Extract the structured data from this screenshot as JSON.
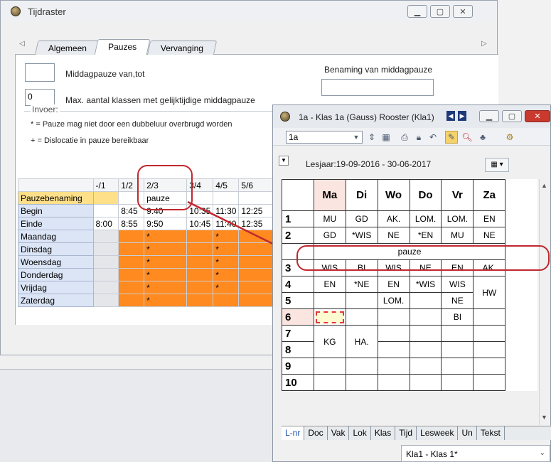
{
  "main_window": {
    "title": "Tijdraster",
    "tabs": [
      "Algemeen",
      "Pauzes",
      "Vervanging"
    ],
    "middagpauze_label": "Middagpauze van,tot",
    "middagpauze_value": "",
    "max_label": "Max. aantal klassen met gelijktijdige middagpauze",
    "max_value": "0",
    "benaming_label": "Benaming van middagpauze",
    "benaming_value": "",
    "invoer_label": "Invoer:",
    "invoer_line1": "* = Pauze mag niet door een dubbeluur overbrugd worden",
    "invoer_line2": "+ = Dislocatie in pauze bereikbaar"
  },
  "grid": {
    "columns": [
      "-/1",
      "1/2",
      "2/3",
      "3/4",
      "4/5",
      "5/6"
    ],
    "rows": [
      {
        "label": "Pauzebenaming",
        "cells": [
          "",
          "",
          "pauze",
          "",
          "",
          ""
        ]
      },
      {
        "label": "Begin",
        "cells": [
          "",
          "8:45",
          "9:40",
          "10:35",
          "11:30",
          "12:25"
        ]
      },
      {
        "label": "Einde",
        "cells": [
          "8:00",
          "8:55",
          "9:50",
          "10:45",
          "11:40",
          "12:35"
        ]
      },
      {
        "label": "Maandag",
        "cells": [
          "",
          "",
          "*",
          "",
          "*",
          ""
        ]
      },
      {
        "label": "Dinsdag",
        "cells": [
          "",
          "",
          "*",
          "",
          "*",
          ""
        ]
      },
      {
        "label": "Woensdag",
        "cells": [
          "",
          "",
          "*",
          "",
          "*",
          ""
        ]
      },
      {
        "label": "Donderdag",
        "cells": [
          "",
          "",
          "*",
          "",
          "*",
          ""
        ]
      },
      {
        "label": "Vrijdag",
        "cells": [
          "",
          "",
          "*",
          "",
          "*",
          ""
        ]
      },
      {
        "label": "Zaterdag",
        "cells": [
          "",
          "",
          "*",
          "",
          "",
          ""
        ]
      }
    ]
  },
  "schedule_window": {
    "title": "1a - Klas 1a (Gauss)  Rooster  (Kla1)",
    "class_value": "1a",
    "lesjaar": "Lesjaar:19-09-2016 - 30-06-2017",
    "days": [
      "Ma",
      "Di",
      "Wo",
      "Do",
      "Vr",
      "Za"
    ],
    "periods": [
      "1",
      "2",
      "3",
      "4",
      "5",
      "6",
      "7",
      "8",
      "9",
      "10"
    ],
    "pause_label": "pauze",
    "row1": [
      "MU",
      "GD",
      "AK.",
      "LOM.",
      "LOM.",
      "EN"
    ],
    "row2": [
      "GD",
      "*WIS",
      "NE",
      "*EN",
      "MU",
      "NE"
    ],
    "row3": [
      "WIS",
      "BI",
      "WIS",
      "NE",
      "EN",
      "AK."
    ],
    "row4": [
      "EN",
      "*NE",
      "EN",
      "*WIS",
      "WIS",
      "HW"
    ],
    "row5": [
      "",
      "",
      "LOM.",
      "",
      "NE"
    ],
    "row6": [
      "",
      "",
      "",
      "",
      "BI",
      ""
    ],
    "row7_8": [
      "KG",
      "HA."
    ],
    "bottom_tabs": [
      "L-nr",
      "Doc",
      "Vak",
      "Lok",
      "Klas",
      "Tijd",
      "Lesweek",
      "Un",
      "Tekst"
    ],
    "class_combo": "Kla1 - Klas 1*"
  },
  "colors": {
    "orange": "#ff8a1f",
    "highlight": "#c0282e",
    "row_header": "#dbe5f6"
  }
}
